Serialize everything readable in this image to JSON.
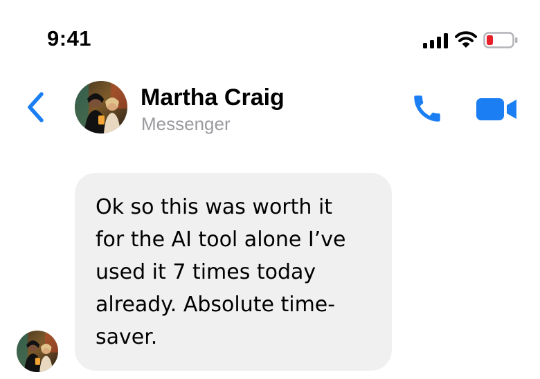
{
  "status_bar": {
    "time": "9:41",
    "icons": [
      "cellular-signal-icon",
      "wifi-icon",
      "battery-low-icon"
    ],
    "battery_color": "#e8202a"
  },
  "header": {
    "back_icon": "chevron-left-icon",
    "contact_name": "Martha Craig",
    "subtitle": "Messenger",
    "actions": [
      "phone-icon",
      "video-camera-icon"
    ],
    "accent_color": "#1b7ef2"
  },
  "conversation": {
    "messages": [
      {
        "direction": "incoming",
        "text": "Ok so this was worth it\nfor the AI tool alone I’ve\nused it 7 times today\nalready. Absolute time-\nsaver."
      }
    ]
  }
}
